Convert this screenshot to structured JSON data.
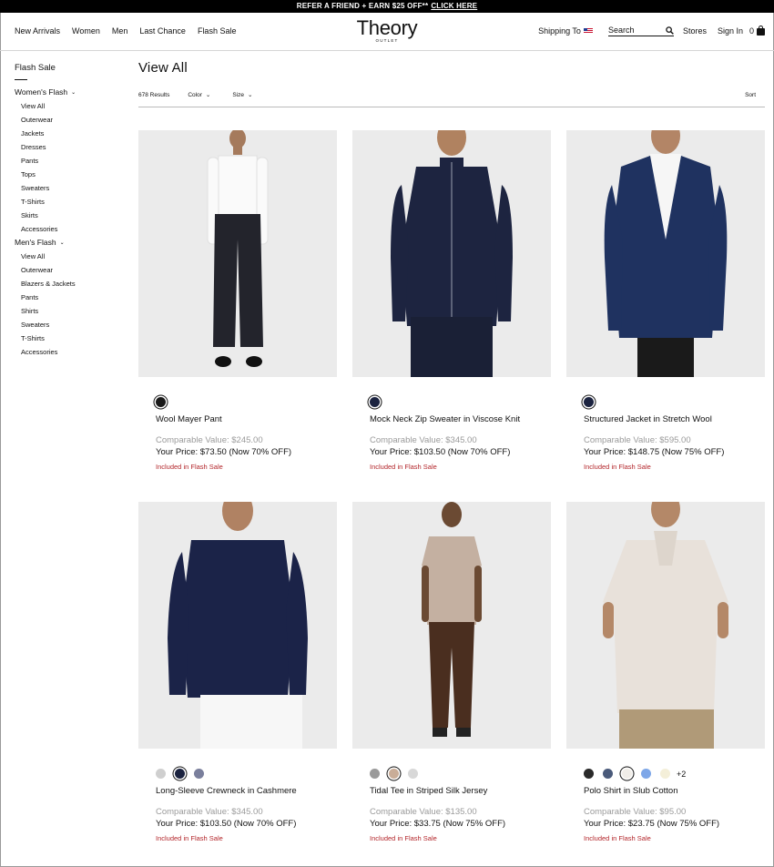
{
  "promo": {
    "text": "REFER A FRIEND + EARN $25 OFF**",
    "link": "CLICK HERE"
  },
  "nav": [
    "New Arrivals",
    "Women",
    "Men",
    "Last Chance",
    "Flash Sale"
  ],
  "logo": {
    "word": "Theory",
    "sub": "OUTLET"
  },
  "utility": {
    "shipping_label": "Shipping To",
    "search_placeholder": "Search",
    "stores": "Stores",
    "sign_in": "Sign In",
    "cart_count": "0"
  },
  "sidebar": {
    "title": "Flash Sale",
    "womens": {
      "label": "Women's Flash",
      "items": [
        "View All",
        "Outerwear",
        "Jackets",
        "Dresses",
        "Pants",
        "Tops",
        "Sweaters",
        "T-Shirts",
        "Skirts",
        "Accessories"
      ]
    },
    "mens": {
      "label": "Men's Flash",
      "items": [
        "View All",
        "Outerwear",
        "Blazers & Jackets",
        "Pants",
        "Shirts",
        "Sweaters",
        "T-Shirts",
        "Accessories"
      ]
    }
  },
  "main": {
    "title": "View All",
    "results": "678 Results",
    "filters": [
      "Color",
      "Size"
    ],
    "sort": "Sort"
  },
  "products": [
    {
      "name": "Wool Mayer Pant",
      "comparable": "Comparable Value: $245.00",
      "price": "Your Price: $73.50 (Now 70% OFF)",
      "flash": "Included in Flash Sale",
      "swatches": [
        "#1a1a1a"
      ],
      "selected": 0,
      "more": ""
    },
    {
      "name": "Mock Neck Zip Sweater in Viscose Knit",
      "comparable": "Comparable Value: $345.00",
      "price": "Your Price: $103.50 (Now 70% OFF)",
      "flash": "Included in Flash Sale",
      "swatches": [
        "#1b2340"
      ],
      "selected": 0,
      "more": ""
    },
    {
      "name": "Structured Jacket in Stretch Wool",
      "comparable": "Comparable Value: $595.00",
      "price": "Your Price: $148.75 (Now 75% OFF)",
      "flash": "Included in Flash Sale",
      "swatches": [
        "#1b2340"
      ],
      "selected": 0,
      "more": ""
    },
    {
      "name": "Long-Sleeve Crewneck in Cashmere",
      "comparable": "Comparable Value: $345.00",
      "price": "Your Price: $103.50 (Now 70% OFF)",
      "flash": "Included in Flash Sale",
      "swatches": [
        "#cfcfcf",
        "#1b2340",
        "#7a7f9c"
      ],
      "selected": 1,
      "more": ""
    },
    {
      "name": "Tidal Tee in Striped Silk Jersey",
      "comparable": "Comparable Value: $135.00",
      "price": "Your Price: $33.75 (Now 75% OFF)",
      "flash": "Included in Flash Sale",
      "swatches": [
        "#9a9a9a",
        "#c9ad98",
        "#d8d8d8"
      ],
      "selected": 1,
      "more": ""
    },
    {
      "name": "Polo Shirt in Slub Cotton",
      "comparable": "Comparable Value: $95.00",
      "price": "Your Price: $23.75 (Now 75% OFF)",
      "flash": "Included in Flash Sale",
      "swatches": [
        "#2a2a2a",
        "#4a5a7a",
        "#f0ede8",
        "#7ea7e8",
        "#f4efd9"
      ],
      "selected": 2,
      "more": "+2"
    }
  ],
  "colors": {
    "flash_red": "#b3262b",
    "muted_gray": "#9a9a9a",
    "photo_bg": "#ebebeb"
  },
  "icons": [
    "search-icon",
    "us-flag-icon",
    "bag-icon",
    "chevron-down-icon"
  ]
}
